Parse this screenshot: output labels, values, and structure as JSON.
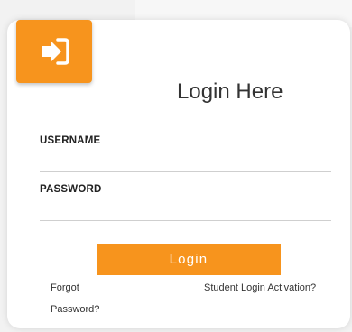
{
  "login": {
    "title": "Login Here",
    "username_label": "USERNAME",
    "password_label": "PASSWORD",
    "button_label": "Login",
    "forgot_line1": "Forgot",
    "forgot_line2": "Password?",
    "activation_link": "Student Login Activation?"
  },
  "icons": {
    "login_icon": "sign-in-arrow-icon"
  },
  "colors": {
    "accent": "#f7941d",
    "card_background": "#ffffff",
    "page_background": "#f2f2f2"
  }
}
